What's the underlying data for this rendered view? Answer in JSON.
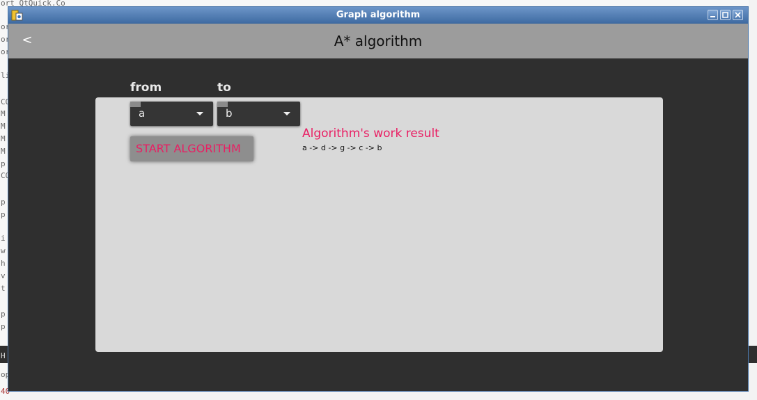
{
  "window": {
    "title": "Graph algorithm"
  },
  "appbar": {
    "back_label": "<",
    "title": "A* algorithm"
  },
  "form": {
    "from_label": "from",
    "to_label": "to",
    "from_value": "a",
    "to_value": "b",
    "start_button_label": "START ALGORITHM"
  },
  "result": {
    "title": "Algorithm's work result",
    "path": "a -> d -> g -> c -> b"
  },
  "background_ide": {
    "code_snippets": [
      "ort QtQuick.Co",
      "or",
      "or",
      "or",
      "li",
      "CO",
      "M",
      "M",
      "M",
      "M",
      "p",
      "CO",
      "p",
      "p",
      "i",
      "w",
      "h",
      "v",
      "t",
      "p",
      "p",
      "Н",
      "ор",
      "40"
    ]
  },
  "colors": {
    "accent": "#e91e63",
    "titlebar": "#4f7bb3",
    "appbar": "#9c9c9c",
    "window_bg": "#2f2f2f",
    "panel_bg": "#d9d9d9"
  },
  "icons": {
    "app": "app-icon",
    "minimize": "minimize-icon",
    "maximize": "maximize-icon",
    "close": "close-icon",
    "dropdown": "chevron-down-icon"
  }
}
